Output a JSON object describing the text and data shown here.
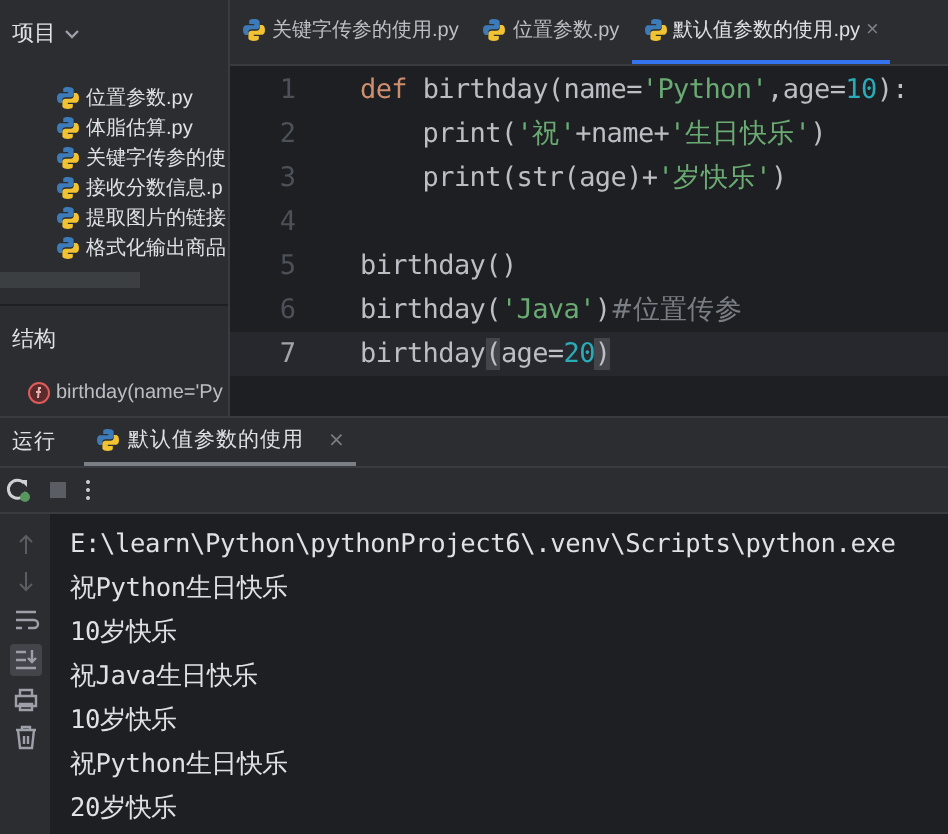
{
  "project_panel": {
    "title": "项目",
    "files": [
      {
        "name": "位置参数.py"
      },
      {
        "name": "体脂估算.py"
      },
      {
        "name": "关键字传参的使"
      },
      {
        "name": "接收分数信息.p"
      },
      {
        "name": "提取图片的链接"
      },
      {
        "name": "格式化输出商品"
      }
    ]
  },
  "structure_panel": {
    "title": "结构",
    "items": [
      "birthday(name='Py"
    ]
  },
  "editor": {
    "tabs": [
      {
        "label": "关键字传参的使用.py",
        "selected": false
      },
      {
        "label": "位置参数.py",
        "selected": false
      },
      {
        "label": "默认值参数的使用.py",
        "selected": true,
        "close": "×"
      }
    ],
    "lines": [
      {
        "number": "1",
        "current": false,
        "tokens": [
          {
            "kind": "keyword",
            "text": "def "
          },
          {
            "kind": "plain",
            "text": "birthday(name="
          },
          {
            "kind": "string",
            "text": "'Python'"
          },
          {
            "kind": "plain",
            "text": ",age="
          },
          {
            "kind": "number",
            "text": "10"
          },
          {
            "kind": "plain",
            "text": "):"
          }
        ]
      },
      {
        "number": "2",
        "current": false,
        "tokens": [
          {
            "kind": "plain",
            "text": "    print("
          },
          {
            "kind": "string",
            "text": "'祝'"
          },
          {
            "kind": "plain",
            "text": "+name+"
          },
          {
            "kind": "string",
            "text": "'生日快乐'"
          },
          {
            "kind": "plain",
            "text": ")"
          }
        ]
      },
      {
        "number": "3",
        "current": false,
        "tokens": [
          {
            "kind": "plain",
            "text": "    print(str(age)+"
          },
          {
            "kind": "string",
            "text": "'岁快乐'"
          },
          {
            "kind": "plain",
            "text": ")"
          }
        ]
      },
      {
        "number": "4",
        "current": false
      },
      {
        "number": "5",
        "current": false,
        "tokens": [
          {
            "kind": "plain",
            "text": "birthday()"
          }
        ]
      },
      {
        "number": "6",
        "current": false,
        "tokens": [
          {
            "kind": "plain",
            "text": "birthday("
          },
          {
            "kind": "string",
            "text": "'Java'"
          },
          {
            "kind": "plain",
            "text": ")"
          },
          {
            "kind": "comment",
            "text": "#位置传参"
          }
        ]
      },
      {
        "number": "7",
        "current": true,
        "tokens": [
          {
            "kind": "plain",
            "text": "birthday"
          },
          {
            "kind": "brace",
            "text": "("
          },
          {
            "kind": "plain",
            "text": "age="
          },
          {
            "kind": "number",
            "text": "20"
          },
          {
            "kind": "brace",
            "text": ")"
          }
        ]
      }
    ]
  },
  "run_panel": {
    "title": "运行",
    "tabs": [
      {
        "label": "默认值参数的使用",
        "selected": true,
        "close": "×"
      }
    ],
    "output": [
      "E:\\learn\\Python\\pythonProject6\\.venv\\Scripts\\python.exe",
      "祝Python生日快乐",
      "10岁快乐",
      "祝Java生日快乐",
      "10岁快乐",
      "祝Python生日快乐",
      "20岁快乐"
    ]
  }
}
